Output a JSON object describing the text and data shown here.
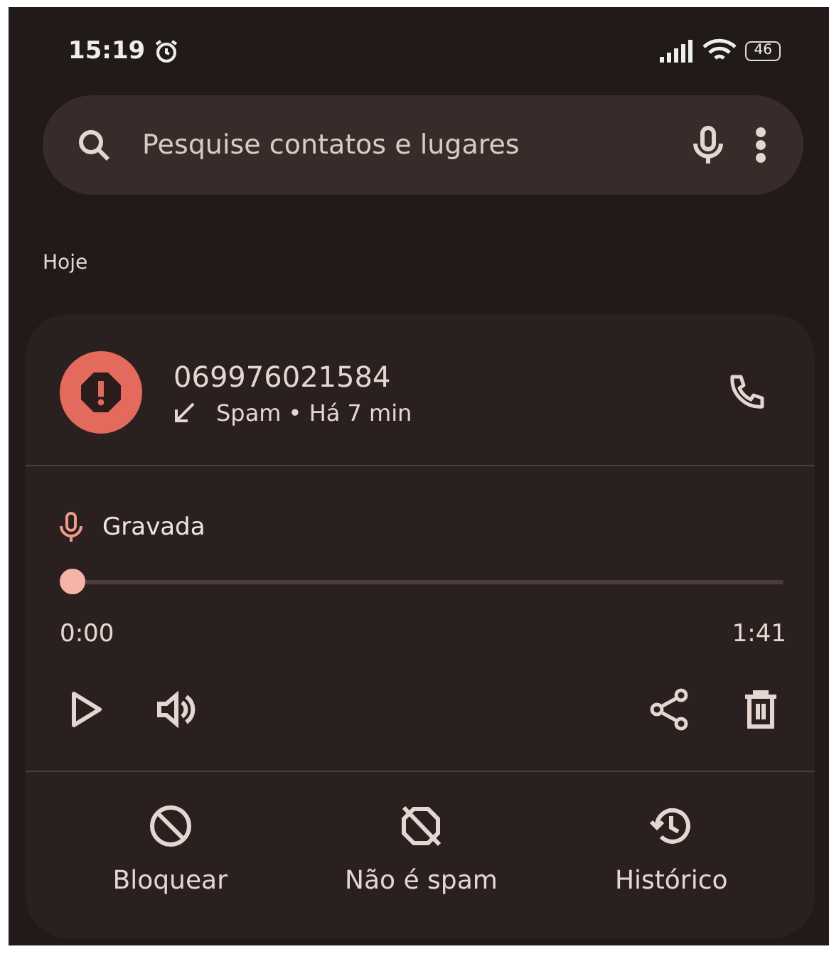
{
  "status_bar": {
    "time": "15:19",
    "battery": "46"
  },
  "search": {
    "placeholder": "Pesquise contatos e lugares"
  },
  "section_header": "Hoje",
  "call": {
    "number": "069976021584",
    "details": "Spam • Há 7 min"
  },
  "recording": {
    "label": "Gravada",
    "level": 0,
    "elapsed": "0:00",
    "duration": "1:41"
  },
  "actions": [
    {
      "kind": "block",
      "label": "Bloquear"
    },
    {
      "kind": "not-spam",
      "label": "Não é spam"
    },
    {
      "kind": "history",
      "label": "Histórico"
    }
  ]
}
